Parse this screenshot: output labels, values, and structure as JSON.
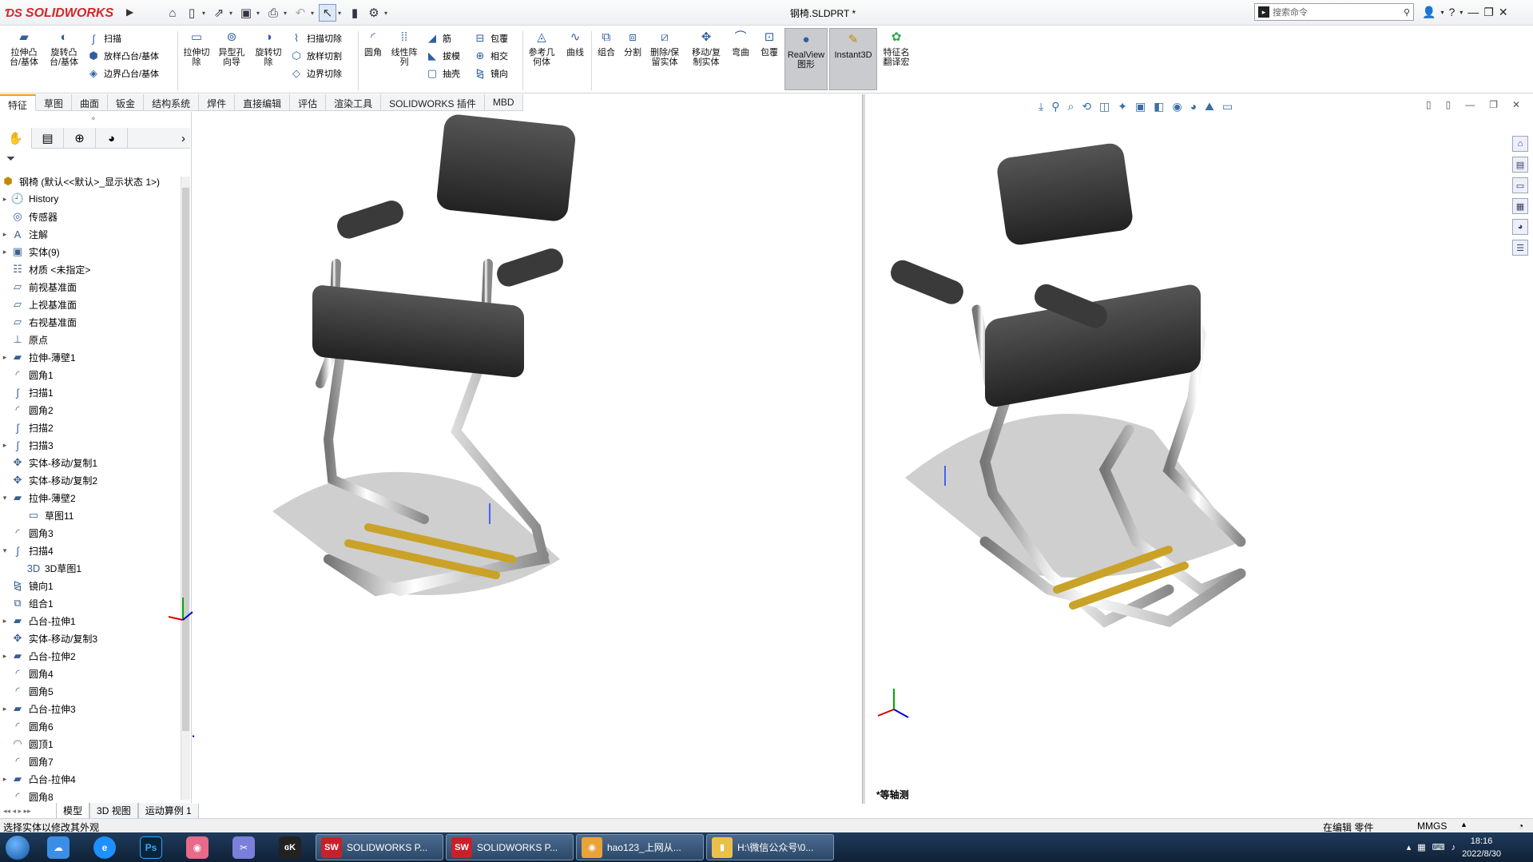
{
  "app": {
    "name": "SOLIDWORKS",
    "doc_title": "钢椅.SLDPRT *"
  },
  "search": {
    "placeholder": "搜索命令"
  },
  "ribbon": {
    "boss_extrude": "拉伸凸\n台/基体",
    "revolve_boss": "旋转凸\n台/基体",
    "sweep": "扫描",
    "loft": "放样凸台/基体",
    "boundary_boss": "边界凸台/基体",
    "extruded_cut": "拉伸切\n除",
    "hole_wizard": "异型孔\n向导",
    "revolved_cut": "旋转切\n除",
    "swept_cut": "扫描切除",
    "lofted_cut": "放样切割",
    "boundary_cut": "边界切除",
    "fillet": "圆角",
    "linear_pattern": "线性阵\n列",
    "rib": "筋",
    "draft": "拔模",
    "shell": "抽壳",
    "wrap": "包覆",
    "intersect": "相交",
    "mirror": "镜向",
    "ref_geometry": "参考几\n何体",
    "curves": "曲线",
    "combine": "组合",
    "split": "分割",
    "delete_keep": "删除/保\n留实体",
    "move_copy": "移动/复\n制实体",
    "flex": "弯曲",
    "wrap2": "包覆",
    "realview": "RealView\n图形",
    "instant3d": "Instant3D",
    "feature_translate": "特征名\n翻译宏"
  },
  "tabs": [
    "特征",
    "草图",
    "曲面",
    "钣金",
    "结构系统",
    "焊件",
    "直接编辑",
    "评估",
    "渲染工具",
    "SOLIDWORKS 插件",
    "MBD"
  ],
  "tree": {
    "root": "钢椅 (默认<<默认>_显示状态 1>)",
    "items": [
      {
        "label": "History",
        "icon": "history-icon",
        "expand": "▸",
        "indent": 0
      },
      {
        "label": "传感器",
        "icon": "sensor-icon",
        "expand": "",
        "indent": 0
      },
      {
        "label": "注解",
        "icon": "annotation-icon",
        "expand": "▸",
        "indent": 0
      },
      {
        "label": "实体(9)",
        "icon": "solid-bodies-icon",
        "expand": "▸",
        "indent": 0
      },
      {
        "label": "材质 <未指定>",
        "icon": "material-icon",
        "expand": "",
        "indent": 0
      },
      {
        "label": "前视基准面",
        "icon": "plane-icon",
        "expand": "",
        "indent": 0
      },
      {
        "label": "上视基准面",
        "icon": "plane-icon",
        "expand": "",
        "indent": 0
      },
      {
        "label": "右视基准面",
        "icon": "plane-icon",
        "expand": "",
        "indent": 0
      },
      {
        "label": "原点",
        "icon": "origin-icon",
        "expand": "",
        "indent": 0
      },
      {
        "label": "拉伸-薄壁1",
        "icon": "extrude-icon",
        "expand": "▸",
        "indent": 0
      },
      {
        "label": "圆角1",
        "icon": "fillet-icon",
        "expand": "",
        "indent": 0
      },
      {
        "label": "扫描1",
        "icon": "sweep-icon",
        "expand": "",
        "indent": 0
      },
      {
        "label": "圆角2",
        "icon": "fillet-icon",
        "expand": "",
        "indent": 0
      },
      {
        "label": "扫描2",
        "icon": "sweep-icon",
        "expand": "",
        "indent": 0
      },
      {
        "label": "扫描3",
        "icon": "sweep-icon",
        "expand": "▸",
        "indent": 0
      },
      {
        "label": "实体-移动/复制1",
        "icon": "move-copy-icon",
        "expand": "",
        "indent": 0
      },
      {
        "label": "实体-移动/复制2",
        "icon": "move-copy-icon",
        "expand": "",
        "indent": 0
      },
      {
        "label": "拉伸-薄壁2",
        "icon": "extrude-icon",
        "expand": "▾",
        "indent": 0
      },
      {
        "label": "草图11",
        "icon": "sketch-icon",
        "expand": "",
        "indent": 1
      },
      {
        "label": "圆角3",
        "icon": "fillet-icon",
        "expand": "",
        "indent": 0
      },
      {
        "label": "扫描4",
        "icon": "sweep-icon",
        "expand": "▾",
        "indent": 0
      },
      {
        "label": "3D草图1",
        "icon": "3d-sketch-icon",
        "expand": "",
        "indent": 1
      },
      {
        "label": "镜向1",
        "icon": "mirror-icon",
        "expand": "",
        "indent": 0
      },
      {
        "label": "组合1",
        "icon": "combine-icon",
        "expand": "",
        "indent": 0
      },
      {
        "label": "凸台-拉伸1",
        "icon": "extrude-icon",
        "expand": "▸",
        "indent": 0
      },
      {
        "label": "实体-移动/复制3",
        "icon": "move-copy-icon",
        "expand": "",
        "indent": 0
      },
      {
        "label": "凸台-拉伸2",
        "icon": "extrude-icon",
        "expand": "▸",
        "indent": 0
      },
      {
        "label": "圆角4",
        "icon": "fillet-icon",
        "expand": "",
        "indent": 0
      },
      {
        "label": "圆角5",
        "icon": "fillet-icon",
        "expand": "",
        "indent": 0
      },
      {
        "label": "凸台-拉伸3",
        "icon": "extrude-icon",
        "expand": "▸",
        "indent": 0
      },
      {
        "label": "圆角6",
        "icon": "fillet-icon",
        "expand": "",
        "indent": 0
      },
      {
        "label": "圆顶1",
        "icon": "dome-icon",
        "expand": "",
        "indent": 0
      },
      {
        "label": "圆角7",
        "icon": "fillet-icon",
        "expand": "",
        "indent": 0
      },
      {
        "label": "凸台-拉伸4",
        "icon": "extrude-icon",
        "expand": "▸",
        "indent": 0
      },
      {
        "label": "圆角8",
        "icon": "fillet-icon",
        "expand": "",
        "indent": 0
      }
    ]
  },
  "bottom_tabs": [
    "模型",
    "3D 视图",
    "运动算例 1"
  ],
  "viewport": {
    "right_label": "*等轴测"
  },
  "status": {
    "left": "选择实体以修改其外观",
    "editing": "在编辑 零件",
    "units": "MMGS"
  },
  "taskbar": {
    "apps": [
      {
        "label": "SOLIDWORKS P...",
        "icon": "solidworks-icon",
        "color": "#c8202a"
      },
      {
        "label": "SOLIDWORKS P...",
        "icon": "solidworks-icon",
        "color": "#c8202a"
      },
      {
        "label": "hao123_上网从...",
        "icon": "chrome-icon",
        "color": "#e8a33a"
      },
      {
        "label": "H:\\微信公众号\\0...",
        "icon": "folder-icon",
        "color": "#e9c04a"
      }
    ],
    "time": "18:16",
    "date": "2022/8/30"
  },
  "colors": {
    "accent": "#f0a000",
    "brand": "#d4262a",
    "taskbar": "#1f3b5c"
  }
}
